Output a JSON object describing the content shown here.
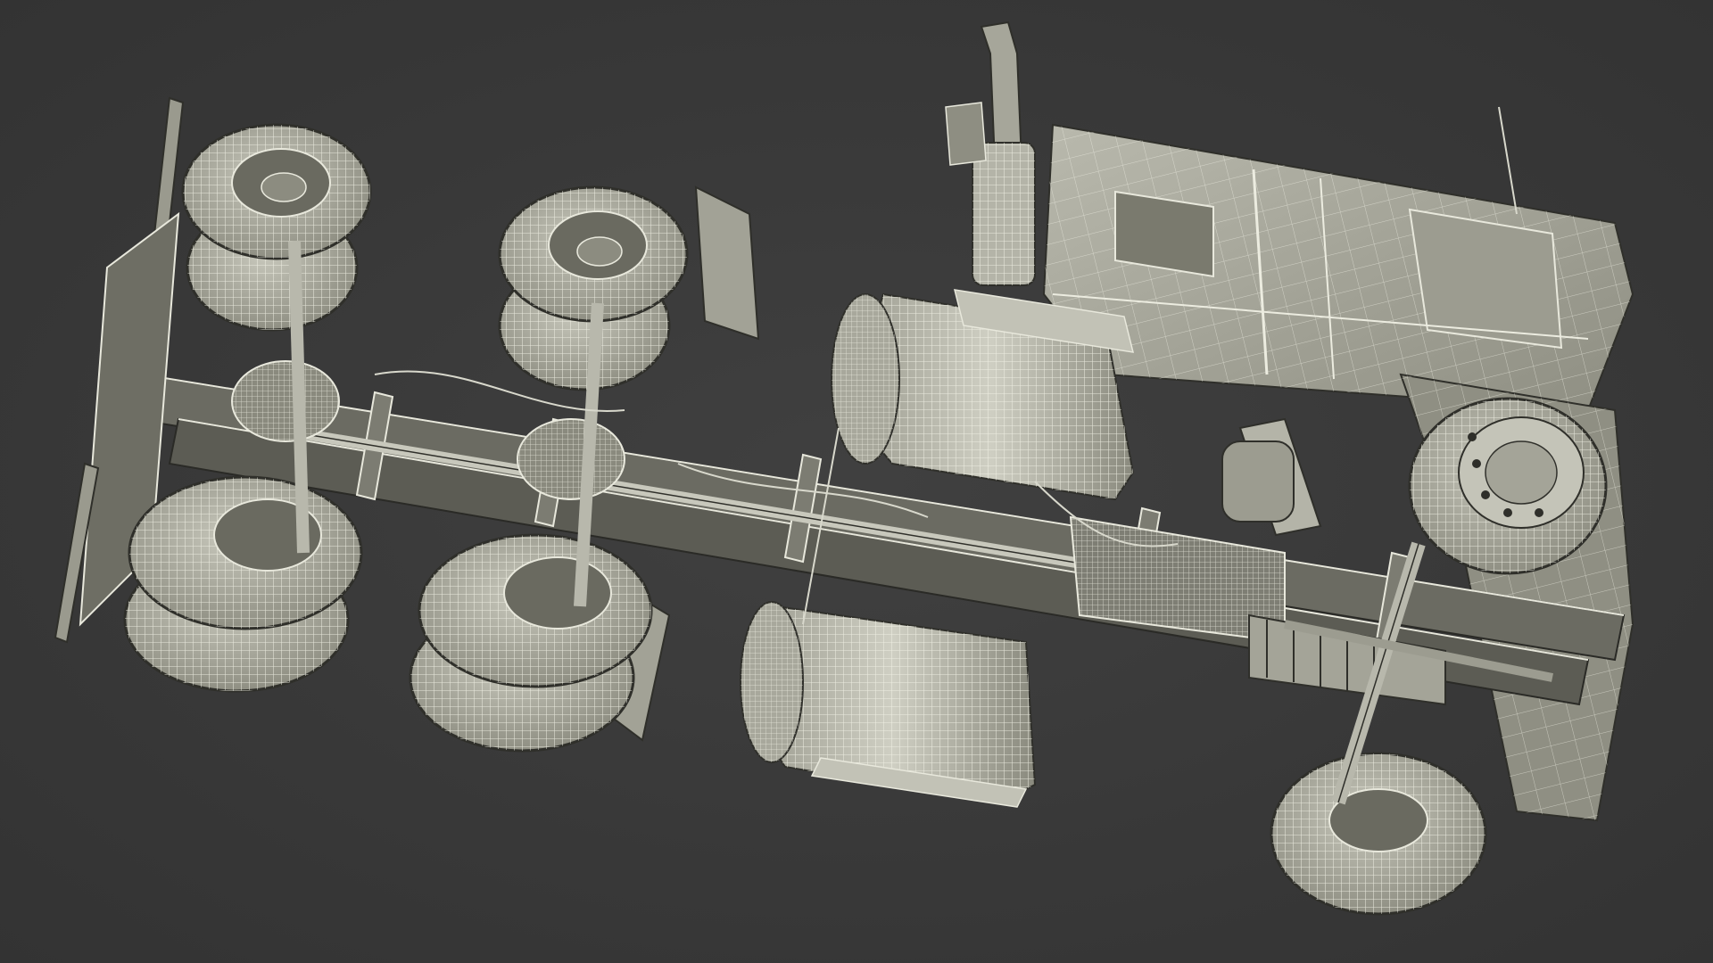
{
  "scene": {
    "subject": "truck-chassis-underside-wireframe",
    "render_style": "clay-wireframe",
    "colors": {
      "background": "#3b3b3b",
      "surface_light": "#d8d8cc",
      "surface_mid": "#a9a99d",
      "surface_dark": "#5a5a52",
      "shadow": "#2a2a26",
      "wire": "#f2f2e6",
      "wire_dark": "#3a3a34"
    }
  }
}
